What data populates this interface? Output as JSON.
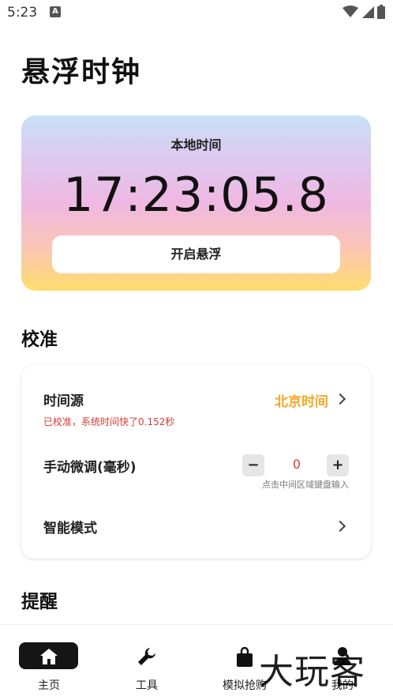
{
  "status_bar": {
    "time": "5:23",
    "notification_glyph": "A"
  },
  "page": {
    "title": "悬浮时钟"
  },
  "clock": {
    "label": "本地时间",
    "time": "17:23:05.8",
    "float_button": "开启悬浮"
  },
  "calibration": {
    "section_title": "校准",
    "time_source": {
      "label": "时间源",
      "value": "北京时间",
      "value_color": "#f5a623"
    },
    "calibration_note": "已校准，系统时间快了0.152秒",
    "manual_adjust": {
      "label": "手动微调(毫秒)",
      "minus": "−",
      "value": "0",
      "plus": "+",
      "hint": "点击中间区域键盘输入"
    },
    "smart_mode": {
      "label": "智能模式"
    }
  },
  "reminder": {
    "section_title": "提醒"
  },
  "nav": {
    "items": [
      {
        "label": "主页",
        "icon": "home-icon",
        "active": true
      },
      {
        "label": "工具",
        "icon": "wrench-icon"
      },
      {
        "label": "模拟抢购",
        "icon": "shopping-bag-icon"
      },
      {
        "label": "我的",
        "icon": "profile-icon"
      }
    ]
  },
  "watermark": {
    "text": "大玩客"
  }
}
